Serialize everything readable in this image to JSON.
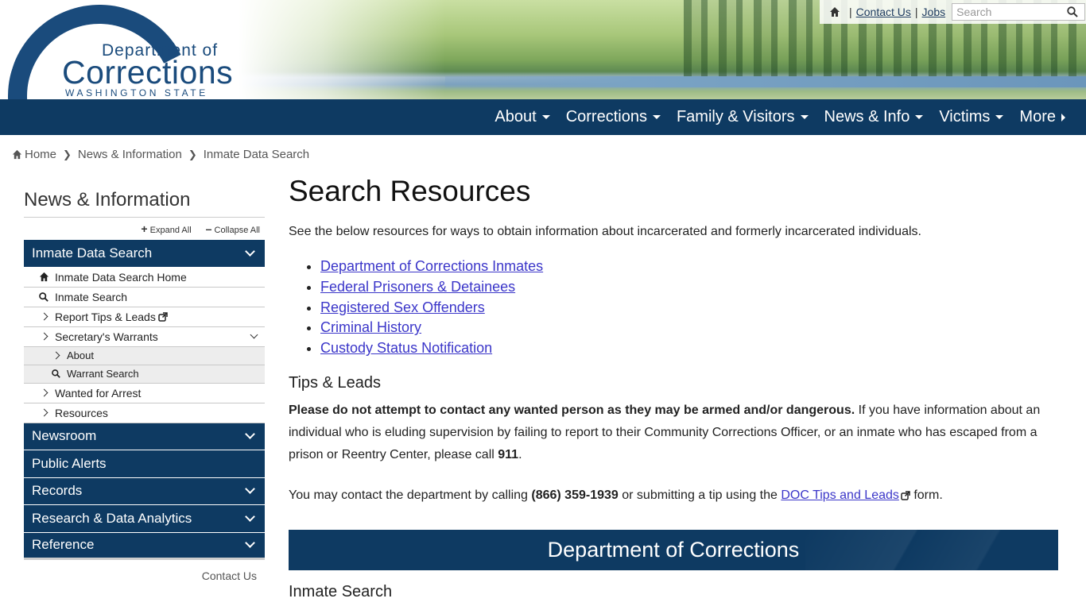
{
  "header": {
    "logo": {
      "line1": "Department of",
      "line2": "Corrections",
      "line3": "WASHINGTON STATE"
    },
    "util": {
      "contact_us": "Contact Us",
      "jobs": "Jobs",
      "search_placeholder": "Search"
    }
  },
  "nav": {
    "items": [
      "About",
      "Corrections",
      "Family & Visitors",
      "News & Info",
      "Victims",
      "More"
    ]
  },
  "breadcrumb": {
    "home": "Home",
    "level1": "News & Information",
    "level2": "Inmate Data Search"
  },
  "sidebar": {
    "title": "News & Information",
    "expand_all": "Expand All",
    "collapse_all": "Collapse All",
    "active_section": "Inmate Data Search",
    "items": {
      "home": "Inmate Data Search Home",
      "search": "Inmate Search",
      "tips": "Report Tips & Leads",
      "warrants": "Secretary's Warrants",
      "warrants_about": "About",
      "warrants_search": "Warrant Search",
      "wanted": "Wanted for Arrest",
      "resources": "Resources"
    },
    "sections": {
      "newsroom": "Newsroom",
      "alerts": "Public Alerts",
      "records": "Records",
      "research": "Research & Data Analytics",
      "reference": "Reference"
    },
    "contact": "Contact Us"
  },
  "main": {
    "title": "Search Resources",
    "intro": "See the below resources for ways to obtain information about incarcerated and formerly incarcerated individuals.",
    "links": [
      "Department of Corrections Inmates",
      "Federal Prisoners & Detainees",
      "Registered Sex Offenders",
      "Criminal History",
      "Custody Status Notification"
    ],
    "tips_heading": "Tips & Leads",
    "tips_bold": "Please do not attempt to contact any wanted person as they may be armed and/or dangerous.",
    "tips_text": " If you have information about an individual who is eluding supervision by failing to report to their Community Corrections Officer, or an inmate who has escaped from a prison or Reentry Center, please call ",
    "tips_number": "911",
    "tips_end": ".",
    "contact_pre": "You may contact the department by calling ",
    "contact_phone": "(866) 359-1939",
    "contact_mid": " or submitting a tip using the ",
    "contact_link": "DOC Tips and Leads",
    "contact_post": " form.",
    "banner": "Department of Corrections",
    "inmate_heading": "Inmate Search"
  },
  "colors": {
    "navy": "#0e3a62",
    "link": "#3b36c9"
  }
}
